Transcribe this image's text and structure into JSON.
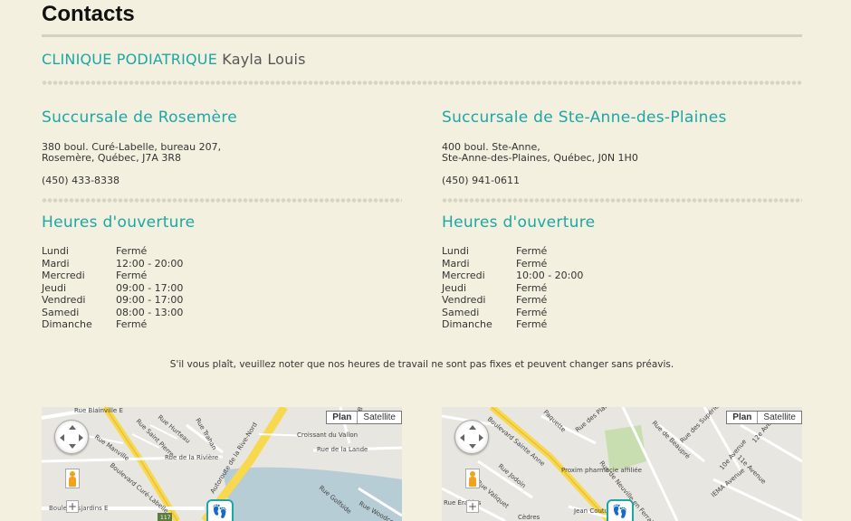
{
  "page": {
    "title": "Contacts",
    "clinic_prefix": "CLINIQUE PODIATRIQUE",
    "clinic_name": "Kayla Louis",
    "notice": "S'il vous plaît, veuillez noter que nos heures de travail ne sont pas fixes et peuvent changer sans préavis."
  },
  "colors": {
    "accent": "#1ba7a4",
    "background": "#f4f0df"
  },
  "branches": [
    {
      "heading": "Succursale de Rosemère",
      "address_line1": "380 boul. Curé-Labelle, bureau 207,",
      "address_line2": "Rosemère, Québec, J7A 3R8",
      "phone": "(450) 433-8338",
      "hours_heading": "Heures d'ouverture",
      "hours": [
        {
          "day": "Lundi",
          "time": "Fermé"
        },
        {
          "day": "Mardi",
          "time": "12:00 - 20:00"
        },
        {
          "day": "Mercredi",
          "time": "Fermé"
        },
        {
          "day": "Jeudi",
          "time": "09:00 - 17:00"
        },
        {
          "day": "Vendredi",
          "time": "09:00 - 17:00"
        },
        {
          "day": "Samedi",
          "time": "08:00 - 13:00"
        },
        {
          "day": "Dimanche",
          "time": "Fermé"
        }
      ],
      "map": {
        "plan_label": "Plan",
        "satellite_label": "Satellite",
        "streets": [
          "Rue Blainville E",
          "Rue Hurteau",
          "Rue Saint Pierre",
          "Rue Manville",
          "Rue Trahan",
          "Boulevard Curé-Labelle",
          "Rue de la Rivière",
          "Autoroute de la Rive-Nord",
          "Croissant du Vallon",
          "Rue Bouquet",
          "Rue de la Lande",
          "Rue Golfside",
          "Rue Woodcock",
          "Boule Desjardins E",
          "117"
        ]
      }
    },
    {
      "heading": "Succursale de Ste-Anne-des-Plaines",
      "address_line1": "400 boul. Ste-Anne,",
      "address_line2": "Ste-Anne-des-Plaines, Québec, J0N 1H0",
      "phone": "(450) 941-0611",
      "hours_heading": "Heures d'ouverture",
      "hours": [
        {
          "day": "Lundi",
          "time": "Fermé"
        },
        {
          "day": "Mardi",
          "time": "Fermé"
        },
        {
          "day": "Mercredi",
          "time": "10:00 - 20:00"
        },
        {
          "day": "Jeudi",
          "time": "Fermé"
        },
        {
          "day": "Vendredi",
          "time": "Fermé"
        },
        {
          "day": "Samedi",
          "time": "Fermé"
        },
        {
          "day": "Dimanche",
          "time": "Fermé"
        }
      ],
      "map": {
        "plan_label": "Plan",
        "satellite_label": "Satellite",
        "streets": [
          "Paquette",
          "Rue des Plaines",
          "Rue de Beaupré",
          "Rue des Supérieures",
          "Boulevard Sainte Anne",
          "Rue de Neuville en Ferrain",
          "Rue Jodoin",
          "Rue Valiquet",
          "Proxim pharmacie affiliée",
          "Jean Coutu",
          "10e Avenue",
          "11e Avenue",
          "12e Avenue",
          "Rue Érables",
          "Cèdres",
          "IEMA Avenue"
        ]
      }
    }
  ]
}
